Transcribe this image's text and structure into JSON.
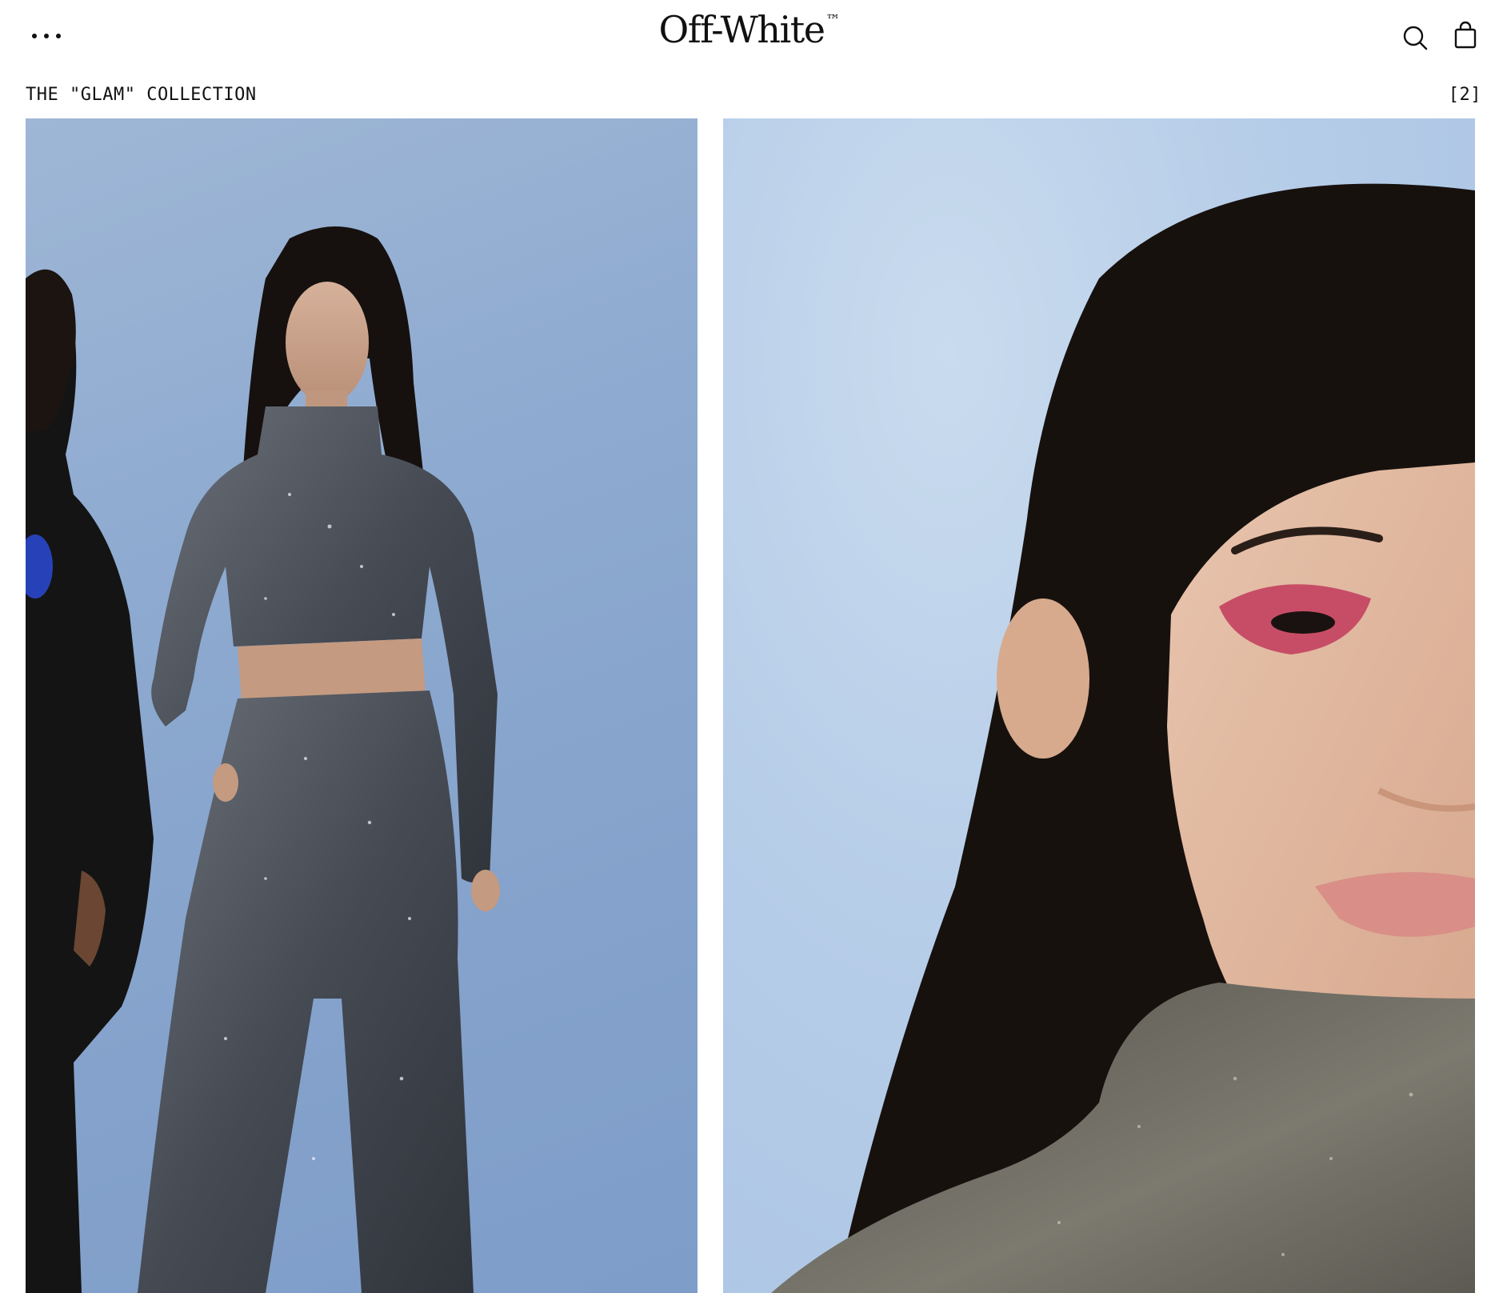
{
  "header": {
    "menu_icon": "more-dots-icon",
    "logo_text": "Off-White",
    "logo_trademark": "™",
    "search_icon": "search-icon",
    "bag_icon": "shopping-bag-icon"
  },
  "collection": {
    "title": "THE \"GLAM\" COLLECTION",
    "count": "[2]"
  },
  "images": [
    {
      "alt": "Model in sequined turtleneck crop top and trousers"
    },
    {
      "alt": "Close-up of model with pink eyeshadow and metallic turtleneck"
    }
  ],
  "colors": {
    "background": "#ffffff",
    "text": "#111111",
    "backdrop_blue": "#8eaad0",
    "garment_silver": "#4a4f57",
    "eye_makeup": "#c23a5c"
  }
}
